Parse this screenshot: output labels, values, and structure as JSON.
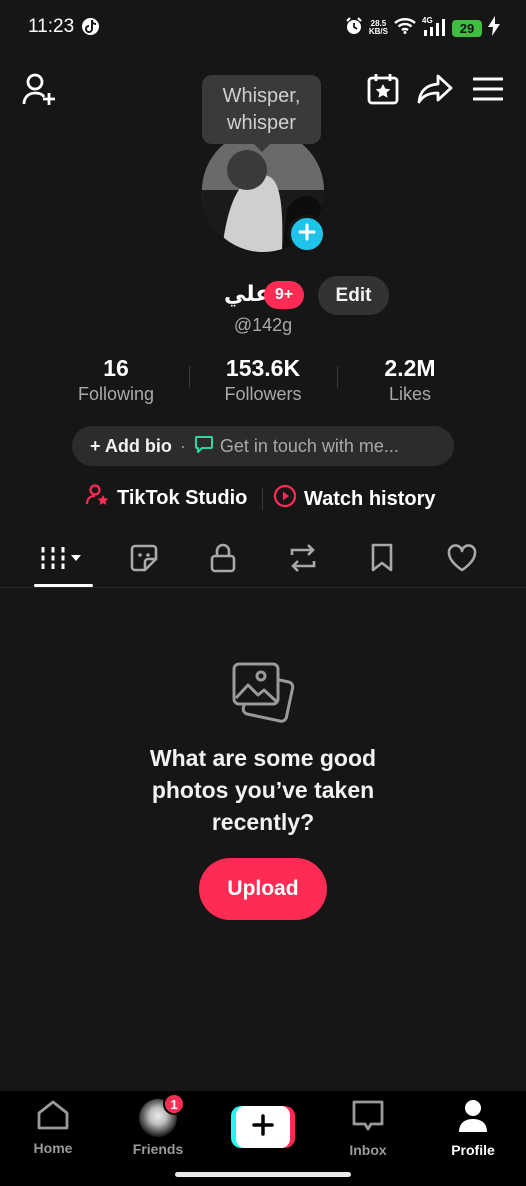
{
  "status_bar": {
    "time": "11:23",
    "net_speed_value": "28.5",
    "net_speed_unit": "KB/S",
    "signal_label": "4G",
    "battery": "29"
  },
  "tooltip": {
    "line1": "Whisper,",
    "line2": "whisper"
  },
  "profile": {
    "username": "علي",
    "notification_badge": "9+",
    "edit_label": "Edit",
    "handle": "@142g"
  },
  "stats": [
    {
      "value": "16",
      "label": "Following"
    },
    {
      "value": "153.6K",
      "label": "Followers"
    },
    {
      "value": "2.2M",
      "label": "Likes"
    }
  ],
  "bio": {
    "add_label": "+ Add bio",
    "separator": "·",
    "contact_label": "Get in touch with me..."
  },
  "links": {
    "studio_label": "TikTok Studio",
    "history_label": "Watch history"
  },
  "empty_state": {
    "line1": "What are some good",
    "line2": "photos you’ve taken",
    "line3": "recently?",
    "upload_label": "Upload"
  },
  "bottom_nav": {
    "home": "Home",
    "friends": "Friends",
    "friends_badge": "1",
    "inbox": "Inbox",
    "profile": "Profile"
  },
  "colors": {
    "background": "#161616",
    "accent_red": "#fe2c55",
    "accent_cyan": "#20c4ea",
    "contact_green": "#2fd7a0"
  }
}
